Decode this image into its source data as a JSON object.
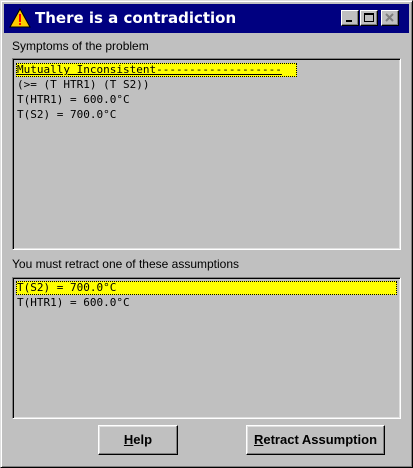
{
  "window": {
    "title": "There is a contradiction",
    "icon": "warning-icon",
    "controls": [
      "minimize-icon",
      "maximize-icon",
      "close-icon"
    ]
  },
  "symptoms": {
    "label": "Symptoms of the problem",
    "items": [
      {
        "text": "Mutually Inconsistent-------------------",
        "selected": true
      },
      {
        "text": "(>= (T HTR1) (T S2))",
        "selected": false
      },
      {
        "text": "T(HTR1) = 600.0°C",
        "selected": false
      },
      {
        "text": "T(S2) = 700.0°C",
        "selected": false
      }
    ]
  },
  "assumptions": {
    "label": "You must retract one of these assumptions",
    "items": [
      {
        "text": "T(S2) = 700.0°C",
        "selected": true
      },
      {
        "text": "T(HTR1) = 600.0°C",
        "selected": false
      }
    ]
  },
  "buttons": {
    "help": {
      "first": "H",
      "rest": "elp"
    },
    "retract": {
      "first": "R",
      "rest": "etract Assumption"
    }
  },
  "colors": {
    "titlebar": "#000080",
    "selection": "#ffff00",
    "face": "#c0c0c0",
    "warning_fill": "#ffcc00",
    "warning_mark": "#ff0000"
  }
}
